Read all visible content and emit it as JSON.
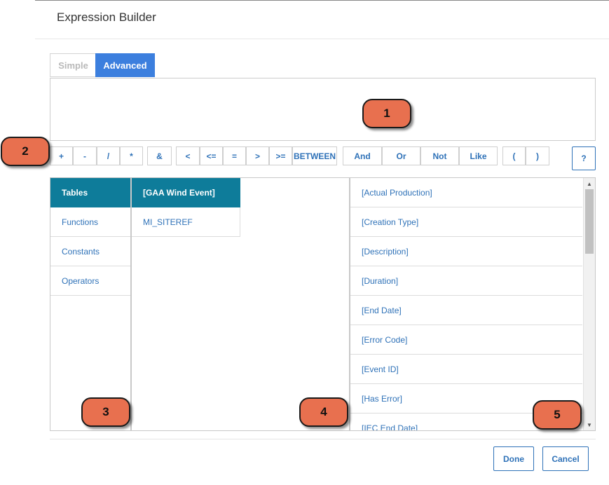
{
  "dialog": {
    "title": "Expression Builder"
  },
  "tabs": [
    {
      "label": "Simple",
      "active": false
    },
    {
      "label": "Advanced",
      "active": true
    }
  ],
  "expression": {
    "value": ""
  },
  "operators": [
    "+",
    "-",
    "/",
    "*",
    "&",
    "<",
    "<=",
    "=",
    ">",
    ">=",
    "BETWEEN",
    "And",
    "Or",
    "Not",
    "Like",
    "(",
    ")"
  ],
  "help_label": "?",
  "categories": [
    {
      "label": "Tables",
      "selected": true
    },
    {
      "label": "Functions",
      "selected": false
    },
    {
      "label": "Constants",
      "selected": false
    },
    {
      "label": "Operators",
      "selected": false
    }
  ],
  "tables": [
    {
      "label": "[GAA Wind Event]",
      "selected": true
    },
    {
      "label": "MI_SITEREF",
      "selected": false
    }
  ],
  "fields": [
    "[Actual Production]",
    "[Creation Type]",
    "[Description]",
    "[Duration]",
    "[End Date]",
    "[Error Code]",
    "[Event ID]",
    "[Has Error]",
    "[IEC End Date]"
  ],
  "footer": {
    "done_label": "Done",
    "cancel_label": "Cancel"
  },
  "callouts": [
    "1",
    "2",
    "3",
    "4",
    "5"
  ],
  "colors": {
    "accent": "#3c7fde",
    "selected": "#0e7c9a",
    "link": "#2f72b8",
    "callout": "#e8704f"
  }
}
